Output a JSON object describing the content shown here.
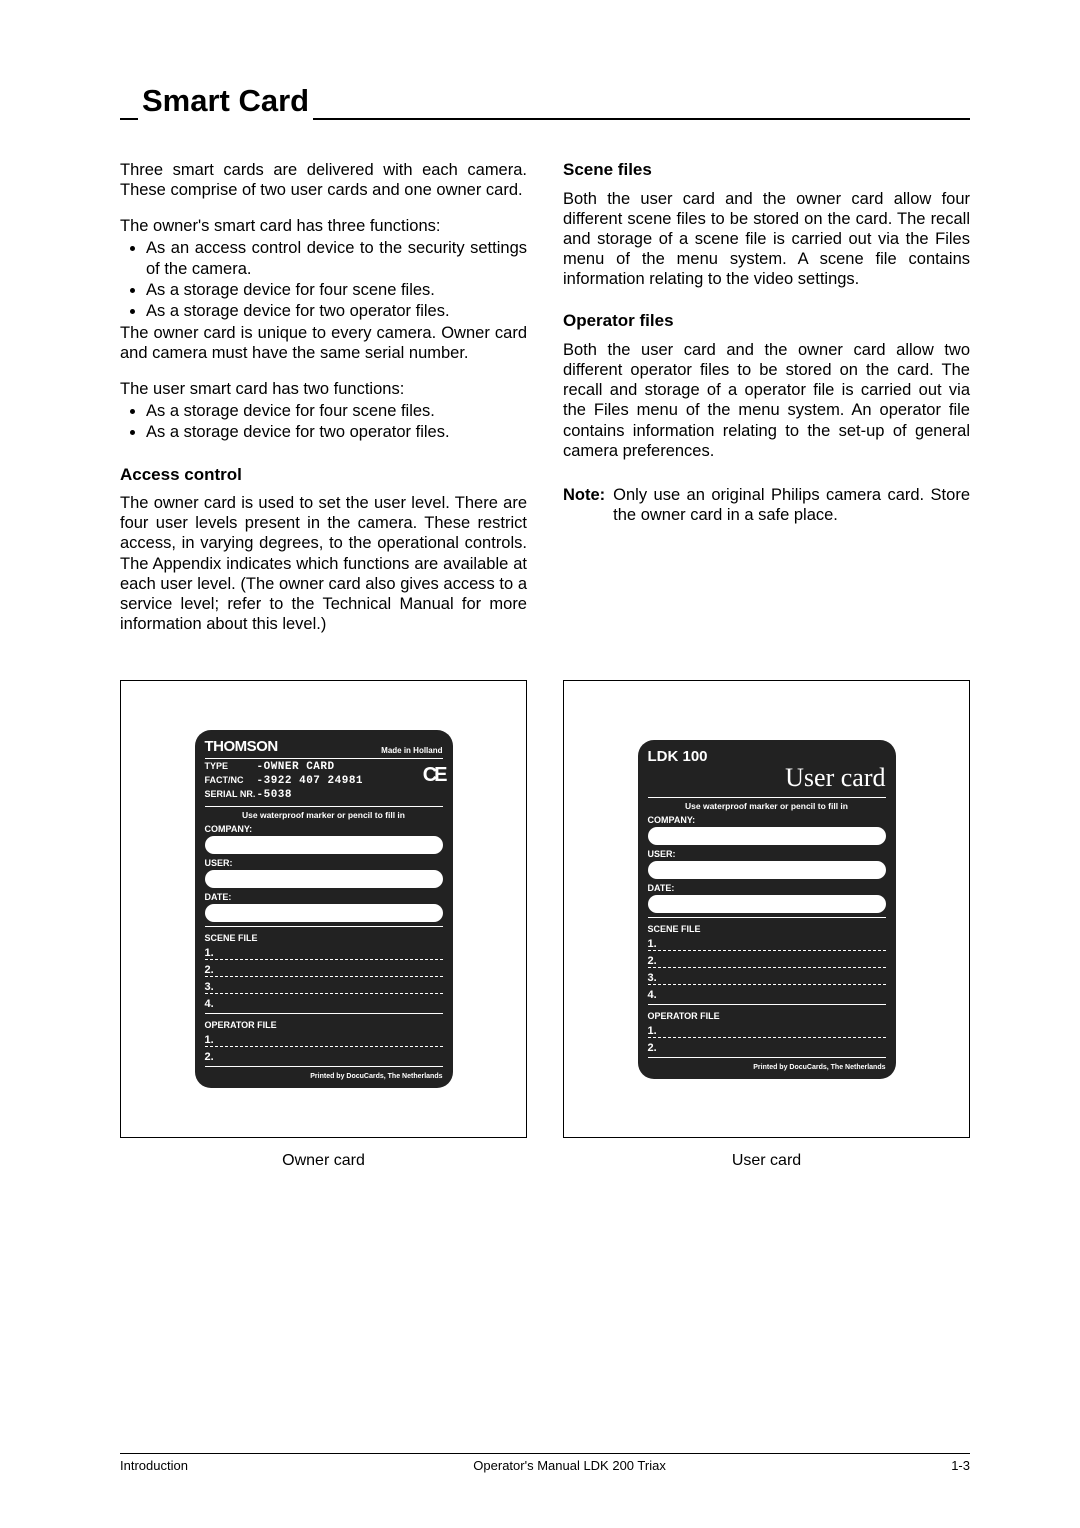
{
  "header": {
    "title": "Smart Card"
  },
  "leftcol": {
    "intro": "Three smart cards are delivered with each camera. These comprise of two user cards and one owner card.",
    "owner_lead": "The owner's smart card has three functions:",
    "owner_bullets": [
      "As an access control device to the security settings of the camera.",
      "As a storage device for four scene files.",
      "As a storage device for two operator files."
    ],
    "owner_tail": "The owner card is unique to every camera. Owner card and camera must have the same serial number.",
    "user_lead": "The user smart card has two functions:",
    "user_bullets": [
      "As a storage device for four scene files.",
      "As a storage device for two operator files."
    ],
    "access_head": "Access control",
    "access_body": "The owner card is used to set the user level. There are four user levels present in the camera. These restrict access, in varying degrees, to the operational controls. The Appendix indicates which functions are available at each user level. (The owner card also gives access to a service level; refer to the Technical Manual for more information about this level.)"
  },
  "rightcol": {
    "scene_head": "Scene files",
    "scene_body": "Both the user card and the owner card allow four different scene files to be stored on the card. The recall and storage of a scene file is carried out via the Files menu of the menu system. A scene file contains information relating to the video settings.",
    "op_head": "Operator files",
    "op_body": "Both the user card and the owner card allow two different operator files to be stored on the card. The recall and storage of a operator file is carried out via the Files menu of the menu system. An operator file contains information relating to the set-up of general camera preferences.",
    "note_label": "Note:",
    "note_body": "Only use an original Philips camera card. Store the owner card in a safe place."
  },
  "ownercard": {
    "brand": "THOMSON",
    "made": "Made in Holland",
    "type_label": "TYPE",
    "type_val": "-OWNER CARD",
    "fact_label": "FACT/NC",
    "fact_val": "-3922 407 24981",
    "serial_label": "SERIAL NR.",
    "serial_val": "-5038",
    "ce": "CE",
    "instr": "Use waterproof marker or pencil to fill in",
    "company": "COMPANY:",
    "user": "USER:",
    "date": "DATE:",
    "scene": "SCENE FILE",
    "nums": [
      "1.",
      "2.",
      "3.",
      "4."
    ],
    "opfile": "OPERATOR FILE",
    "opnums": [
      "1.",
      "2."
    ],
    "printed": "Printed by DocuCards, The Netherlands",
    "caption": "Owner card"
  },
  "usercard": {
    "model": "LDK 100",
    "big": "User card",
    "instr": "Use waterproof marker or pencil to fill in",
    "company": "COMPANY:",
    "user": "USER:",
    "date": "DATE:",
    "scene": "SCENE FILE",
    "nums": [
      "1.",
      "2.",
      "3.",
      "4."
    ],
    "opfile": "OPERATOR FILE",
    "opnums": [
      "1.",
      "2."
    ],
    "printed": "Printed by DocuCards, The Netherlands",
    "caption": "User card"
  },
  "footer": {
    "left": "Introduction",
    "center": "Operator's Manual LDK 200 Triax",
    "right": "1-3"
  }
}
